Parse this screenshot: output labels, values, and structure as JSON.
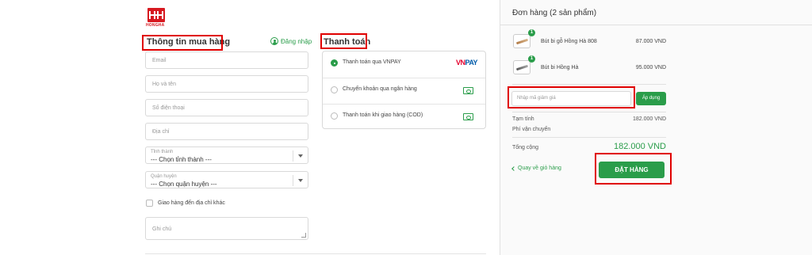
{
  "brand": {
    "logo_text": "HONGHA",
    "color": "#d71920"
  },
  "checkout": {
    "customer_title": "Thông tin mua hàng",
    "login_link": "Đăng nhập",
    "fields": {
      "email": "Email",
      "name": "Họ và tên",
      "phone": "Số điện thoại",
      "address": "Địa chỉ"
    },
    "province": {
      "label": "Tỉnh thành",
      "value": "--- Chọn tỉnh thành ---"
    },
    "district": {
      "label": "Quận huyện",
      "value": "--- Chọn quận huyện ---"
    },
    "ship_other": "Giao hàng đến địa chỉ khác",
    "note": "Ghi chú"
  },
  "payment": {
    "title": "Thanh toán",
    "methods": [
      {
        "label": "Thanh toán qua VNPAY",
        "selected": true,
        "icon": "vnpay-logo"
      },
      {
        "label": "Chuyển khoản qua ngân hàng",
        "selected": false,
        "icon": "cash-icon"
      },
      {
        "label": "Thanh toán khi giao hàng (COD)",
        "selected": false,
        "icon": "cash-icon"
      }
    ],
    "vnpay_vn": "VN",
    "vnpay_pay": "PAY"
  },
  "order": {
    "title": "Đơn hàng (2 sản phẩm)",
    "items": [
      {
        "qty": "1",
        "name": "Bút bi gỗ Hồng Hà 808",
        "price": "87.000 VND"
      },
      {
        "qty": "1",
        "name": "Bút bi Hồng Hà",
        "price": "95.000 VND"
      }
    ],
    "coupon_placeholder": "Nhập mã giảm giá",
    "apply_label": "Áp dụng",
    "subtotal_label": "Tạm tính",
    "subtotal_value": "182.000 VND",
    "shipping_label": "Phí vận chuyển",
    "total_label": "Tổng cộng",
    "total_value": "182.000 VND",
    "back_link": "Quay về giỏ hàng",
    "place_order": "ĐẶT HÀNG"
  },
  "colors": {
    "accent": "#2a9d4a",
    "highlight": "#e00000"
  }
}
